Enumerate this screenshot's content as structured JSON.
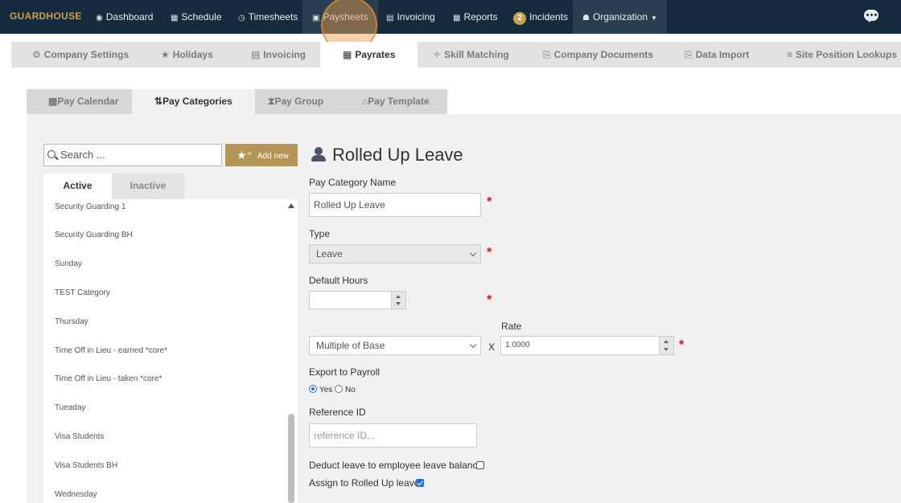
{
  "app": {
    "brand": "GUARDHOUSE"
  },
  "topnav": {
    "dashboard": "Dashboard",
    "schedule": "Schedule",
    "timesheets": "Timesheets",
    "paysheets": "Paysheets",
    "invoicing": "Invoicing",
    "reports": "Reports",
    "incidents_count": "2",
    "incidents": "Incidents",
    "organization": "Organization"
  },
  "subnav": {
    "company_settings": "Company Settings",
    "holidays": "Holidays",
    "invoicing": "Invoicing",
    "payrates": "Payrates",
    "skill_matching": "Skill Matching",
    "company_documents": "Company Documents",
    "data_import": "Data Import",
    "site_position_lookups": "Site Position Lookups"
  },
  "inner_tabs": {
    "pay_calendar": "Pay Calendar",
    "pay_categories": "Pay Categories",
    "pay_group": "Pay Group",
    "pay_template": "Pay Template"
  },
  "list": {
    "search_placeholder": "Search ...",
    "add_new": "Add new",
    "tab_active": "Active",
    "tab_inactive": "Inactive",
    "items": [
      "Security Guarding 1",
      "Security Guarding BH",
      "Sunday",
      "TEST Category",
      "Thursday",
      "Time Off in Lieu - earned *core*",
      "Time Off in Lieu - taken *core*",
      "Tueaday",
      "Visa Students",
      "Visa Students BH",
      "Wednesday"
    ]
  },
  "form": {
    "title": "Rolled Up Leave",
    "pay_category_name_label": "Pay Category Name",
    "pay_category_name_value": "Rolled Up Leave",
    "type_label": "Type",
    "type_value": "Leave",
    "default_hours_label": "Default Hours",
    "default_hours_value": "",
    "rate_label": "Rate",
    "rate_mode": "Multiple of Base",
    "rate_x": "X",
    "rate_value": "1.0000",
    "export_label": "Export to Payroll",
    "export_yes": "Yes",
    "export_no": "No",
    "export_selected": "Yes",
    "reference_label": "Reference ID",
    "reference_placeholder": "reference ID...",
    "deduct_label": "Deduct leave to employee leave balance",
    "deduct_checked": false,
    "rolled_up_label": "Assign to Rolled Up leave",
    "rolled_up_checked": true,
    "required_mark": "*"
  },
  "colors": {
    "nav_bg": "#152a3d",
    "brand": "#c9a34a",
    "add_button": "#b39654",
    "required": "#dd1111",
    "checkbox_checked": "#1a73e8"
  }
}
